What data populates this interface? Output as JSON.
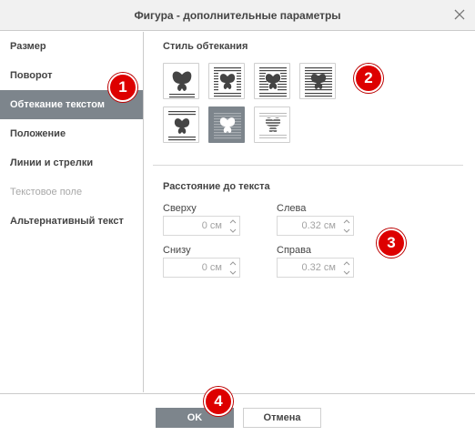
{
  "dialog": {
    "title": "Фигура - дополнительные параметры",
    "close_icon": "close-icon"
  },
  "sidebar": {
    "items": [
      {
        "label": "Размер",
        "state": "normal"
      },
      {
        "label": "Поворот",
        "state": "normal"
      },
      {
        "label": "Обтекание текстом",
        "state": "active"
      },
      {
        "label": "Положение",
        "state": "normal"
      },
      {
        "label": "Линии и стрелки",
        "state": "normal"
      },
      {
        "label": "Текстовое поле",
        "state": "disabled"
      },
      {
        "label": "Альтернативный текст",
        "state": "normal"
      }
    ]
  },
  "wrap_style": {
    "title": "Стиль обтекания",
    "options": [
      {
        "icon": "wrap-inline-icon"
      },
      {
        "icon": "wrap-square-icon"
      },
      {
        "icon": "wrap-tight-icon"
      },
      {
        "icon": "wrap-through-icon"
      },
      {
        "icon": "wrap-top-bottom-icon"
      },
      {
        "icon": "wrap-in-front-icon",
        "selected": true
      },
      {
        "icon": "wrap-behind-icon"
      }
    ]
  },
  "distance": {
    "title": "Расстояние до текста",
    "top": {
      "label": "Сверху",
      "value": "0 см"
    },
    "left": {
      "label": "Слева",
      "value": "0.32 см"
    },
    "bottom": {
      "label": "Снизу",
      "value": "0 см"
    },
    "right": {
      "label": "Справа",
      "value": "0.32 см"
    }
  },
  "footer": {
    "ok_label": "OK",
    "cancel_label": "Отмена"
  },
  "callouts": [
    "1",
    "2",
    "3",
    "4"
  ],
  "colors": {
    "active_bg": "#7d858c",
    "callout_red": "#dd0000",
    "titlebar_bg": "#f1f1f1"
  }
}
